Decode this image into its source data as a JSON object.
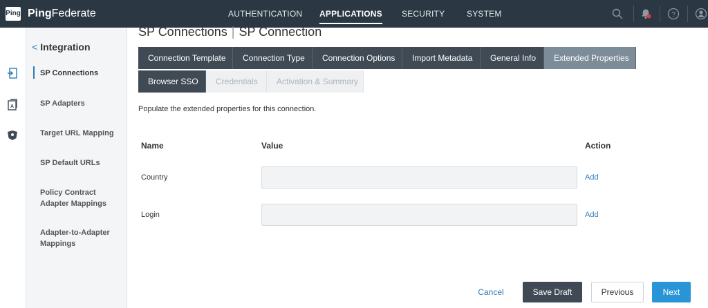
{
  "header": {
    "logo_text": "Ping",
    "brand_bold": "Ping",
    "brand_light": "Federate",
    "nav": [
      {
        "label": "AUTHENTICATION",
        "active": false
      },
      {
        "label": "APPLICATIONS",
        "active": true
      },
      {
        "label": "SECURITY",
        "active": false
      },
      {
        "label": "SYSTEM",
        "active": false
      }
    ],
    "icons": [
      "search-icon",
      "notification-bell-icon",
      "help-icon",
      "user-icon"
    ],
    "notification_color": "#e23b3b"
  },
  "rail": {
    "icons": [
      "sp-connections-icon",
      "sp-adapters-icon",
      "target-url-mapping-icon"
    ],
    "accent": "#2b7bb9"
  },
  "sidenav": {
    "back_label": "Integration",
    "items": [
      {
        "label": "SP Connections",
        "active": true
      },
      {
        "label": "SP Adapters",
        "active": false
      },
      {
        "label": "Target URL Mapping",
        "active": false
      },
      {
        "label": "SP Default URLs",
        "active": false
      },
      {
        "label": "Policy Contract Adapter Mappings",
        "active": false
      },
      {
        "label": "Adapter-to-Adapter Mappings",
        "active": false
      }
    ]
  },
  "main": {
    "breadcrumb": [
      "SP Connections",
      "SP Connection"
    ],
    "tabs_row1": [
      {
        "label": "Connection Template",
        "state": "done"
      },
      {
        "label": "Connection Type",
        "state": "done"
      },
      {
        "label": "Connection Options",
        "state": "done"
      },
      {
        "label": "Import Metadata",
        "state": "done"
      },
      {
        "label": "General Info",
        "state": "done"
      },
      {
        "label": "Extended Properties",
        "state": "current"
      }
    ],
    "tabs_row2": [
      {
        "label": "Browser SSO",
        "state": "done"
      },
      {
        "label": "Credentials",
        "state": "disabled"
      },
      {
        "label": "Activation & Summary",
        "state": "disabled"
      }
    ],
    "intro": "Populate the extended properties for this connection.",
    "table": {
      "headers": {
        "name": "Name",
        "value": "Value",
        "action": "Action"
      },
      "rows": [
        {
          "name": "Country",
          "value": "",
          "action": "Add"
        },
        {
          "name": "Login",
          "value": "",
          "action": "Add"
        }
      ]
    },
    "buttons": {
      "cancel": "Cancel",
      "save_draft": "Save Draft",
      "previous": "Previous",
      "next": "Next"
    }
  }
}
